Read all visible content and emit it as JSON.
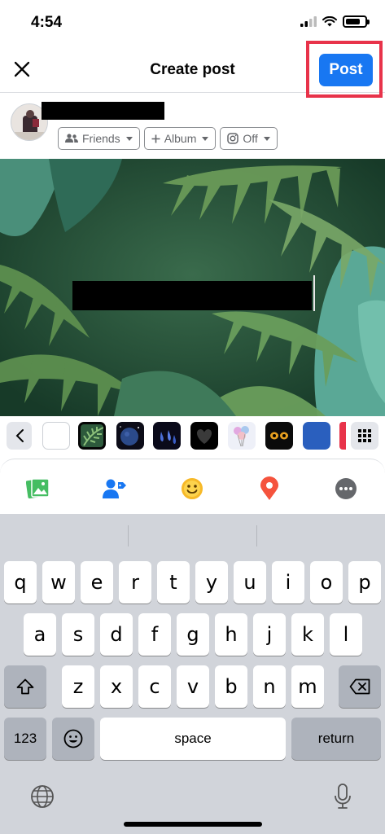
{
  "status_bar": {
    "time": "4:54",
    "battery_level": 0.75
  },
  "header": {
    "title": "Create post",
    "post_label": "Post"
  },
  "audience": {
    "privacy": "Friends",
    "album": "Album",
    "instagram": "Off"
  },
  "keyboard": {
    "rows": [
      [
        "q",
        "w",
        "e",
        "r",
        "t",
        "y",
        "u",
        "i",
        "o",
        "p"
      ],
      [
        "a",
        "s",
        "d",
        "f",
        "g",
        "h",
        "j",
        "k",
        "l"
      ],
      [
        "z",
        "x",
        "c",
        "v",
        "b",
        "n",
        "m"
      ]
    ],
    "numbers_label": "123",
    "space_label": "space",
    "return_label": "return"
  },
  "colors": {
    "accent": "#1877f2",
    "highlight": "#e8334a"
  }
}
